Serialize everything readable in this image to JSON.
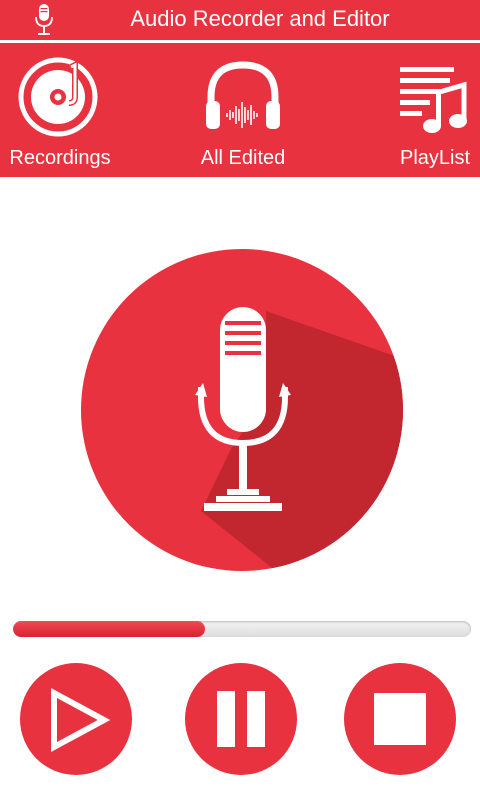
{
  "app": {
    "title": "Audio Recorder and Editor",
    "icon": "microphone-icon",
    "accent_color": "#e8323f",
    "shadow_color": "#c2222f"
  },
  "tabs": [
    {
      "label": "Recordings",
      "icon": "vinyl-disc-icon"
    },
    {
      "label": "All Edited",
      "icon": "headphones-waveform-icon"
    },
    {
      "label": "PlayList",
      "icon": "playlist-music-icon"
    }
  ],
  "recorder": {
    "main_button_icon": "microphone-icon",
    "progress_percent": 42
  },
  "controls": [
    {
      "name": "play",
      "icon": "play-icon"
    },
    {
      "name": "pause",
      "icon": "pause-icon"
    },
    {
      "name": "stop",
      "icon": "stop-icon"
    }
  ]
}
